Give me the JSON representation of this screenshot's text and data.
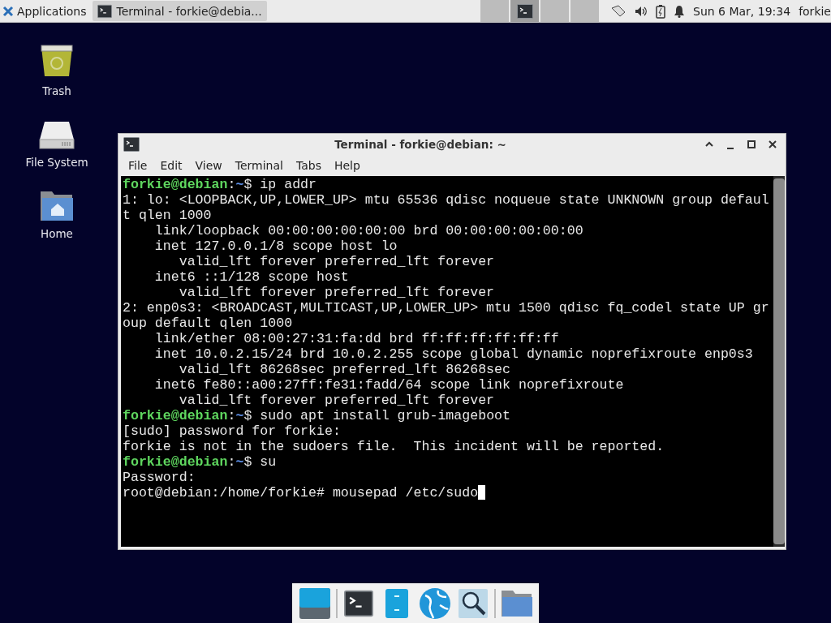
{
  "panel": {
    "applications_menu": "Applications",
    "task_button": "Terminal - forkie@debia...",
    "workspaces": [
      {
        "selected": false,
        "has_window": false
      },
      {
        "selected": true,
        "has_window": true
      },
      {
        "selected": false,
        "has_window": false
      },
      {
        "selected": false,
        "has_window": false
      }
    ],
    "clock": "Sun  6 Mar, 19:34",
    "user": "forkie"
  },
  "desktop_icons": [
    {
      "label": "Trash",
      "kind": "trash"
    },
    {
      "label": "File System",
      "kind": "drive"
    },
    {
      "label": "Home",
      "kind": "home"
    }
  ],
  "window": {
    "title": "Terminal - forkie@debian: ~",
    "menu": [
      "File",
      "Edit",
      "View",
      "Terminal",
      "Tabs",
      "Help"
    ],
    "cursor_visible": true,
    "lines": [
      {
        "kind": "prompt",
        "user": "forkie@debian",
        "sep": ":",
        "path": "~",
        "symbol": "$",
        "command": "ip addr"
      },
      {
        "kind": "output",
        "text": "1: lo: <LOOPBACK,UP,LOWER_UP> mtu 65536 qdisc noqueue state UNKNOWN group defaul"
      },
      {
        "kind": "output",
        "text": "t qlen 1000"
      },
      {
        "kind": "output",
        "text": "    link/loopback 00:00:00:00:00:00 brd 00:00:00:00:00:00"
      },
      {
        "kind": "output",
        "text": "    inet 127.0.0.1/8 scope host lo"
      },
      {
        "kind": "output",
        "text": "       valid_lft forever preferred_lft forever"
      },
      {
        "kind": "output",
        "text": "    inet6 ::1/128 scope host"
      },
      {
        "kind": "output",
        "text": "       valid_lft forever preferred_lft forever"
      },
      {
        "kind": "output",
        "text": "2: enp0s3: <BROADCAST,MULTICAST,UP,LOWER_UP> mtu 1500 qdisc fq_codel state UP gr"
      },
      {
        "kind": "output",
        "text": "oup default qlen 1000"
      },
      {
        "kind": "output",
        "text": "    link/ether 08:00:27:31:fa:dd brd ff:ff:ff:ff:ff:ff"
      },
      {
        "kind": "output",
        "text": "    inet 10.0.2.15/24 brd 10.0.2.255 scope global dynamic noprefixroute enp0s3"
      },
      {
        "kind": "output",
        "text": "       valid_lft 86268sec preferred_lft 86268sec"
      },
      {
        "kind": "output",
        "text": "    inet6 fe80::a00:27ff:fe31:fadd/64 scope link noprefixroute"
      },
      {
        "kind": "output",
        "text": "       valid_lft forever preferred_lft forever"
      },
      {
        "kind": "prompt",
        "user": "forkie@debian",
        "sep": ":",
        "path": "~",
        "symbol": "$",
        "command": "sudo apt install grub-imageboot"
      },
      {
        "kind": "output",
        "text": "[sudo] password for forkie:"
      },
      {
        "kind": "output",
        "text": "forkie is not in the sudoers file.  This incident will be reported."
      },
      {
        "kind": "prompt",
        "user": "forkie@debian",
        "sep": ":",
        "path": "~",
        "symbol": "$",
        "command": "su"
      },
      {
        "kind": "output",
        "text": "Password:"
      },
      {
        "kind": "output",
        "text": "root@debian:/home/forkie# mousepad /etc/sudo"
      }
    ]
  },
  "dock": [
    {
      "kind": "desktop"
    },
    {
      "kind": "separator"
    },
    {
      "kind": "terminal"
    },
    {
      "kind": "files"
    },
    {
      "kind": "browser"
    },
    {
      "kind": "search"
    },
    {
      "kind": "separator"
    },
    {
      "kind": "folder"
    }
  ]
}
